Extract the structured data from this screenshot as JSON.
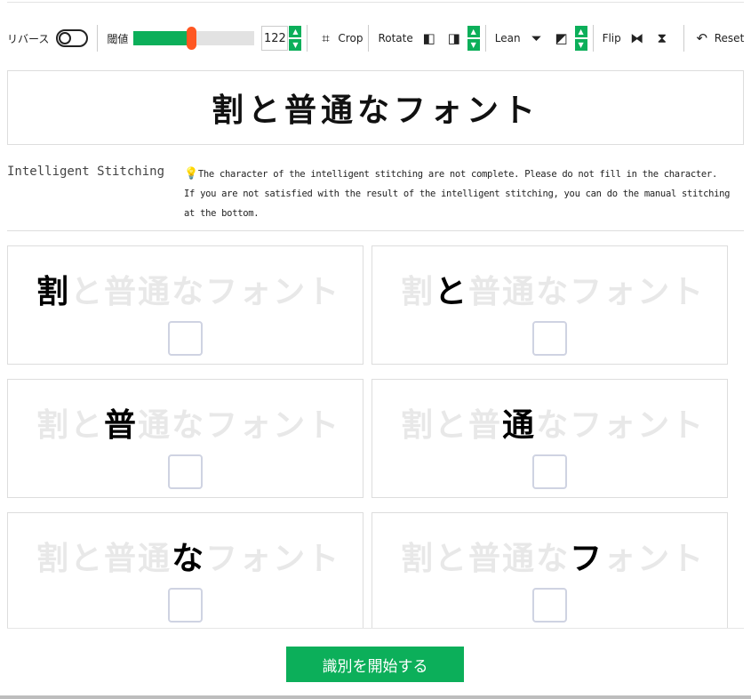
{
  "toolbar": {
    "reverse_label": "リバース",
    "reverse_on": false,
    "threshold_label": "閾値",
    "threshold_value": "122",
    "threshold_max": 255,
    "crop_label": "Crop",
    "rotate_label": "Rotate",
    "lean_label": "Lean",
    "flip_label": "Flip",
    "reset_label": "Reset"
  },
  "preview_text": "割と普通なフォント",
  "stitching": {
    "label": "Intelligent Stitching",
    "notice": "The character of the intelligent stitching are not complete. Please do not fill in the character. If you are not satisfied with the result of the intelligent stitching, you can do the manual stitching at the bottom."
  },
  "cards": [
    {
      "char_index": 0,
      "checked": false
    },
    {
      "char_index": 1,
      "checked": false
    },
    {
      "char_index": 2,
      "checked": false
    },
    {
      "char_index": 3,
      "checked": false
    },
    {
      "char_index": 4,
      "checked": false
    },
    {
      "char_index": 5,
      "checked": false
    }
  ],
  "start_button": "識別を開始する",
  "colors": {
    "accent": "#0caf5a",
    "thumb": "#ff5722"
  }
}
